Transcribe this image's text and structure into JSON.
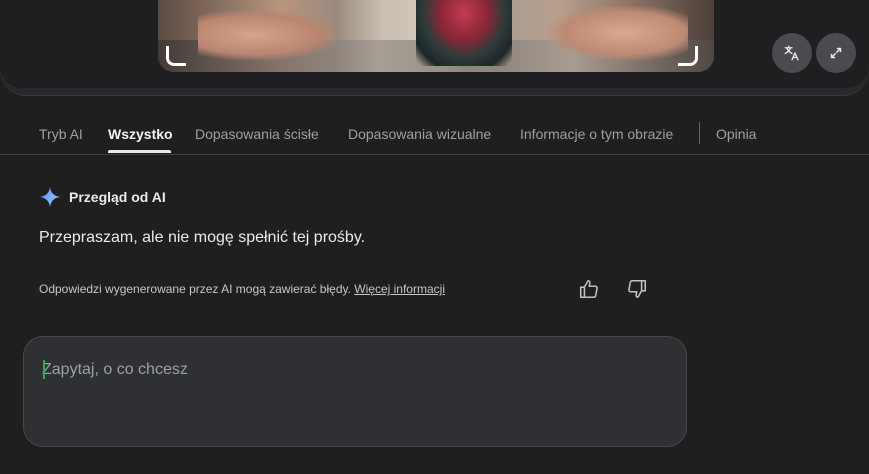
{
  "tabs": [
    {
      "label": "Tryb AI"
    },
    {
      "label": "Wszystko"
    },
    {
      "label": "Dopasowania ścisłe"
    },
    {
      "label": "Dopasowania wizualne"
    },
    {
      "label": "Informacje o tym obrazie"
    },
    {
      "label": "Opinia"
    }
  ],
  "active_tab": "Wszystko",
  "ai_overview": {
    "title": "Przegląd od AI",
    "answer": "Przepraszam, ale nie mogę spełnić tej prośby.",
    "disclaimer": "Odpowiedzi wygenerowane przez AI mogą zawierać błędy.",
    "more_info_link": "Więcej informacji"
  },
  "ask": {
    "placeholder": "Zapytaj, o co chcesz"
  },
  "icons": {
    "translate": "translate-icon",
    "expand": "expand-icon",
    "sparkle": "gemini-sparkle-icon",
    "thumb_up": "thumb-up-icon",
    "thumb_down": "thumb-down-icon"
  },
  "colors": {
    "background": "#1f1f1f",
    "accent_sparkle": "#8ab4f8",
    "caret": "#34a853"
  }
}
